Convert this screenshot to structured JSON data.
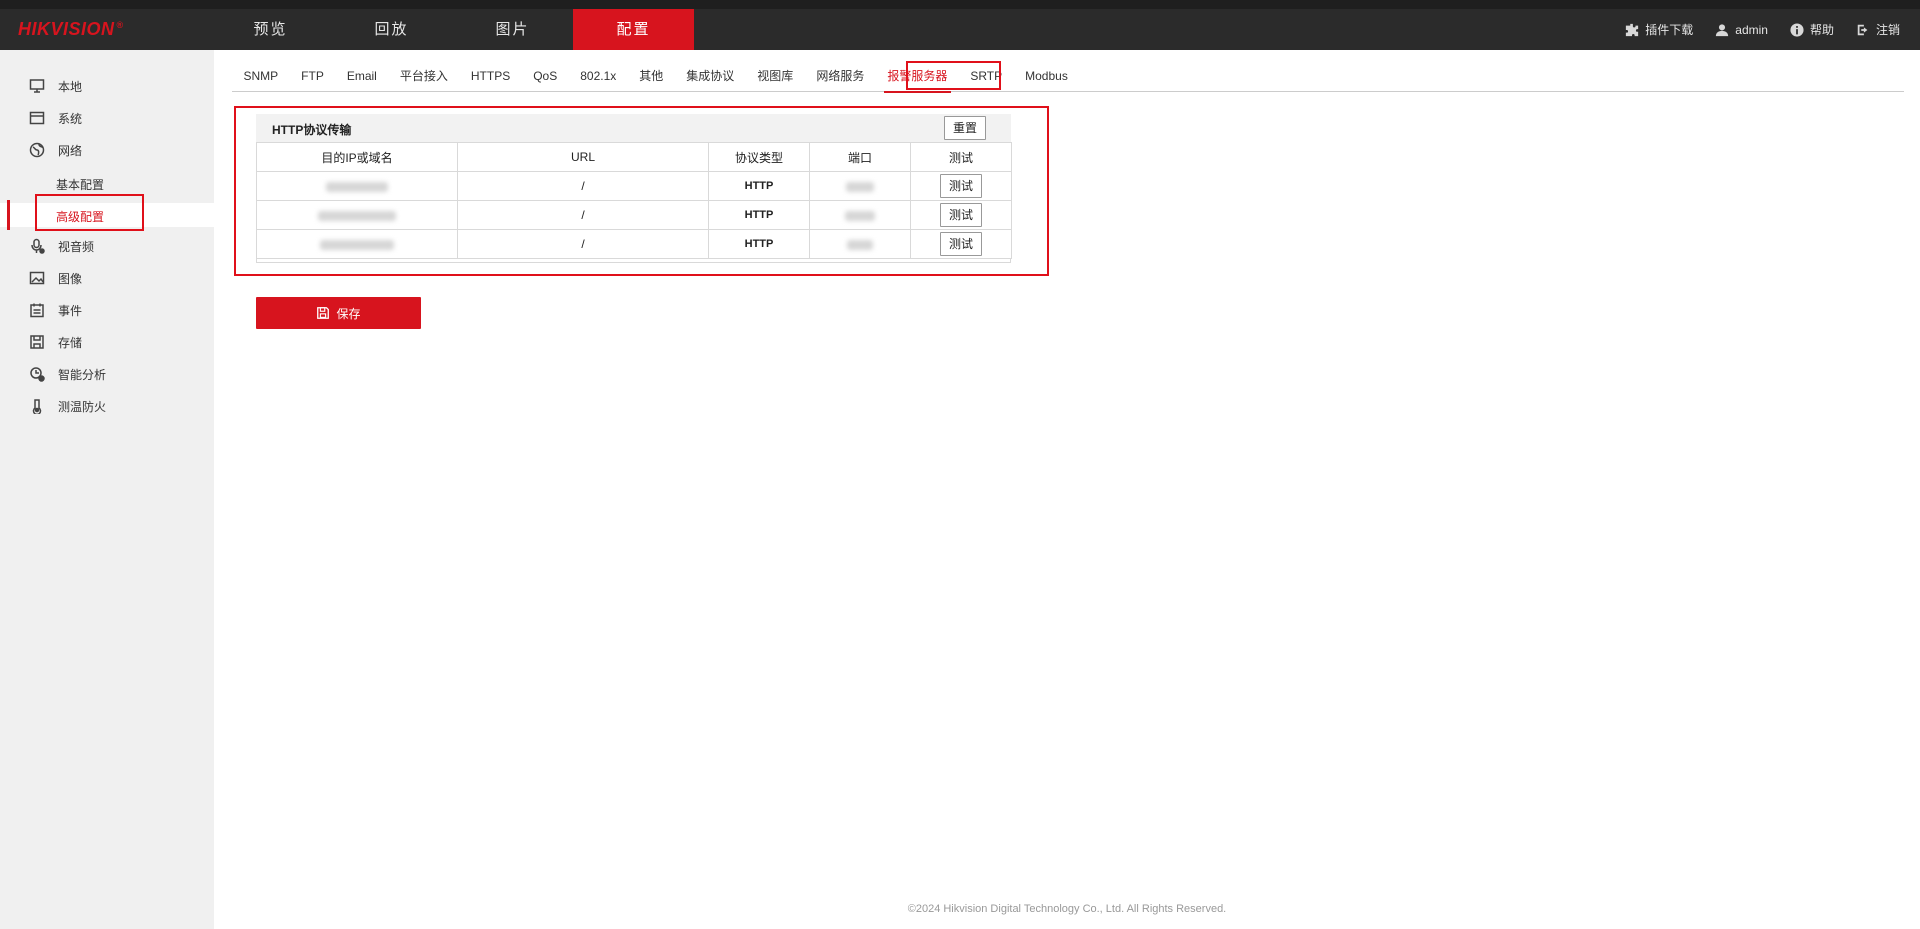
{
  "brand": {
    "logo": "HIKVISION",
    "reg": "®"
  },
  "mainnav": [
    "预览",
    "回放",
    "图片",
    "配置"
  ],
  "topright": {
    "plugin": "插件下载",
    "user": "admin",
    "help": "帮助",
    "logout": "注销"
  },
  "sidebar": {
    "items": [
      {
        "label": "本地",
        "icon": "monitor-icon"
      },
      {
        "label": "系统",
        "icon": "system-icon"
      },
      {
        "label": "网络",
        "icon": "globe-icon"
      },
      {
        "label": "视音频",
        "icon": "mic-icon"
      },
      {
        "label": "图像",
        "icon": "image-icon"
      },
      {
        "label": "事件",
        "icon": "calendar-icon"
      },
      {
        "label": "存储",
        "icon": "storage-icon"
      },
      {
        "label": "智能分析",
        "icon": "analysis-icon"
      },
      {
        "label": "测温防火",
        "icon": "temperature-icon"
      }
    ],
    "sub": [
      "基本配置",
      "高级配置"
    ]
  },
  "tabs": [
    "SNMP",
    "FTP",
    "Email",
    "平台接入",
    "HTTPS",
    "QoS",
    "802.1x",
    "其他",
    "集成协议",
    "视图库",
    "网络服务",
    "报警服务器",
    "SRTP",
    "Modbus"
  ],
  "panel": {
    "title": "HTTP协议传输",
    "reset": "重置",
    "columns": [
      "目的IP或域名",
      "URL",
      "协议类型",
      "端口",
      "测试"
    ],
    "rows": [
      {
        "url": "/",
        "protocol": "HTTP",
        "test": "测试"
      },
      {
        "url": "/",
        "protocol": "HTTP",
        "test": "测试"
      },
      {
        "url": "/",
        "protocol": "HTTP",
        "test": "测试"
      }
    ]
  },
  "save": "保存",
  "footer": "©2024 Hikvision Digital Technology Co., Ltd. All Rights Reserved.",
  "colors": {
    "accent": "#d7141e",
    "topbar": "#2b2b2b",
    "sidebar": "#f0f0f0"
  }
}
